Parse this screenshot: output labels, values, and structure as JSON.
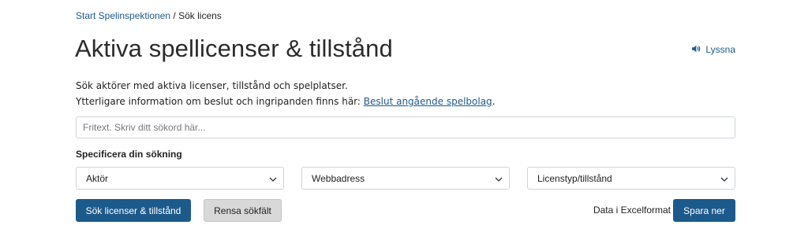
{
  "breadcrumb": {
    "home": "Start Spelinspektionen",
    "separator": "/",
    "current": "Sök licens"
  },
  "header": {
    "title": "Aktiva spellicenser & tillstånd",
    "listen_label": "Lyssna",
    "listen_icon": "speaker-icon"
  },
  "intro": {
    "line1": "Sök aktörer med aktiva licenser, tillstånd och spelplatser.",
    "line2_prefix": "Ytterligare information om beslut och ingripanden finns här:",
    "line2_link": "Beslut angående spelbolag",
    "line2_suffix": "."
  },
  "search": {
    "placeholder": "Fritext. Skriv ditt sökord här...",
    "value": ""
  },
  "filters": {
    "heading": "Specificera din sökning",
    "actor": "Aktör",
    "web_address": "Webbadress",
    "license_type": "Licenstyp/tillstånd",
    "dropdown_icon": "chevron-down-icon"
  },
  "actions": {
    "search_button": "Sök licenser & tillstånd",
    "clear_button": "Rensa sökfält",
    "excel_label": "Data i Excelformat",
    "save_button": "Spara ner"
  },
  "colors": {
    "accent": "#1d5a8c",
    "clear_button_bg": "#d8d8d8",
    "border": "#cfd4d9"
  }
}
